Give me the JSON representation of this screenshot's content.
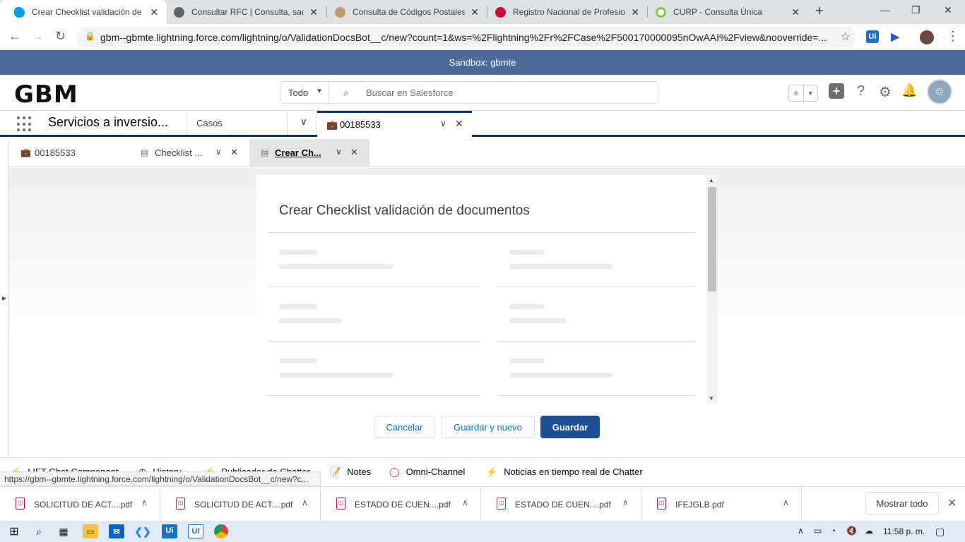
{
  "browser": {
    "tabs": [
      {
        "title": "Crear Checklist validación de d",
        "favicon_color": "#00a1e0"
      },
      {
        "title": "Consultar RFC | Consulta, saca",
        "favicon_color": "#5f6368"
      },
      {
        "title": "Consulta de Códigos Postales",
        "favicon_color": "#c19a6b"
      },
      {
        "title": "Registro Nacional de Profesion",
        "favicon_color": "#c8102e"
      },
      {
        "title": "CURP - Consulta Única",
        "favicon_color": "#8bc34a"
      }
    ],
    "new_tab": "+",
    "window_controls": {
      "minimize": "—",
      "restore": "❐",
      "close": "✕"
    },
    "url": "gbm--gbmte.lightning.force.com/lightning/o/ValidationDocsBot__c/new?count=1&ws=%2Flightning%2Fr%2FCase%2F500170000095nOwAAI%2Fview&nooverride=...",
    "extensions": [
      {
        "label": "Ui",
        "color": "#1f6fc5"
      },
      {
        "label": "▶",
        "color": "#2b57d4"
      }
    ]
  },
  "sandbox_banner": "Sandbox: gbmte",
  "header": {
    "logo": "GBM",
    "search_scope": "Todo",
    "search_placeholder": "Buscar en Salesforce"
  },
  "app_nav": {
    "app_name": "Servicios a inversio...",
    "object_selector": "Casos",
    "workspace_tab": "00185533"
  },
  "subtabs": [
    {
      "label": "00185533",
      "icon": "briefcase-icon"
    },
    {
      "label": "Checklist ...",
      "icon": "record-icon"
    },
    {
      "label": "Crear Ch...",
      "icon": "record-icon",
      "active": true
    }
  ],
  "modal": {
    "title": "Crear Checklist validación de documentos",
    "buttons": {
      "cancel": "Cancelar",
      "save_new": "Guardar y nuevo",
      "save": "Guardar"
    }
  },
  "utility_bar": [
    {
      "label": "LIFT Chat Component",
      "icon": "⚡"
    },
    {
      "label": "History",
      "icon": "◷"
    },
    {
      "label": "Publicador de Chatter",
      "icon": "⚡"
    },
    {
      "label": "Notes",
      "icon": "📝"
    },
    {
      "label": "Omni-Channel",
      "icon": "◯"
    },
    {
      "label": "Noticias en tiempo real de Chatter",
      "icon": "⚡"
    }
  ],
  "status_url": "https://gbm--gbmte.lightning.force.com/lightning/o/ValidationDocsBot__c/new?c...",
  "downloads": [
    {
      "name": "SOLICITUD DE ACT....pdf"
    },
    {
      "name": "SOLICITUD DE ACT....pdf"
    },
    {
      "name": "ESTADO DE CUEN....pdf"
    },
    {
      "name": "ESTADO DE CUEN....pdf"
    },
    {
      "name": "IFEJGLB.pdf"
    }
  ],
  "show_all": "Mostrar todo",
  "taskbar": {
    "clock": "11:58 p. m."
  }
}
